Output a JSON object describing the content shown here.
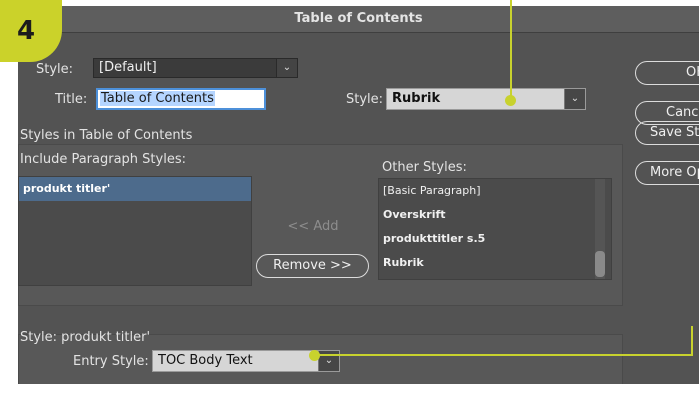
{
  "window": {
    "title": "Table of Contents"
  },
  "step_badge": "4",
  "toc_style": {
    "label": "Style:",
    "value": "[Default]",
    "partial_label": "Style:"
  },
  "title_field": {
    "label": "Title:",
    "value": "Table of Contents"
  },
  "title_style": {
    "label": "Style:",
    "value": "Rubrik"
  },
  "styles_group": {
    "heading": "Styles in Table of Contents",
    "include_label": "Include Paragraph Styles:",
    "included": [
      "produkt titler'"
    ],
    "add_label": "<< Add",
    "remove_label": "Remove >>",
    "other_label": "Other Styles:",
    "other": [
      "[Basic Paragraph]",
      "Overskrift",
      "produkttitler s.5",
      "Rubrik"
    ]
  },
  "style_detail": {
    "heading": "Style: produkt titler'",
    "entry_label": "Entry Style:",
    "entry_value": "TOC Body Text"
  },
  "buttons": {
    "ok": "OK",
    "cancel": "Cancel",
    "save_style": "Save Style...",
    "more_options": "More Options"
  },
  "colors": {
    "callout": "#c8d22e",
    "selection": "#4d6b8c",
    "dialog_bg": "#535353"
  }
}
